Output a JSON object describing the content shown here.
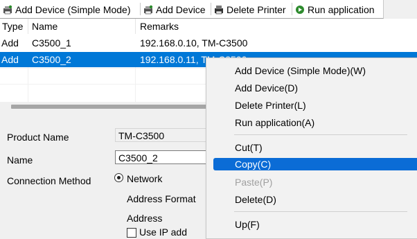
{
  "toolbar": {
    "add_device_simple": "Add Device (Simple Mode)",
    "add_device": "Add Device",
    "delete_printer": "Delete Printer",
    "run_application": "Run application"
  },
  "list": {
    "columns": [
      "Type",
      "Name",
      "Remarks"
    ],
    "rows": [
      {
        "type": "Add",
        "name": "C3500_1",
        "remarks": "192.168.0.10, TM-C3500"
      },
      {
        "type": "Add",
        "name": "C3500_2",
        "remarks": "192.168.0.11, TM-C3500"
      }
    ]
  },
  "form": {
    "product_name_label": "Product Name",
    "product_name_value": "TM-C3500",
    "name_label": "Name",
    "name_value": "C3500_2",
    "connection_method_label": "Connection Method",
    "network_option": "Network",
    "address_format_label": "Address Format",
    "address_label": "Address",
    "partial_checkbox_label": "Use IP add"
  },
  "context_menu": {
    "items": [
      "Add Device (Simple Mode)(W)",
      "Add Device(D)",
      "Delete Printer(L)",
      "Run application(A)",
      "Cut(T)",
      "Copy(C)",
      "Paste(P)",
      "Delete(D)",
      "Up(F)"
    ]
  },
  "colors": {
    "selection": "#0078d7",
    "menu_highlight": "#0b6cd6"
  }
}
